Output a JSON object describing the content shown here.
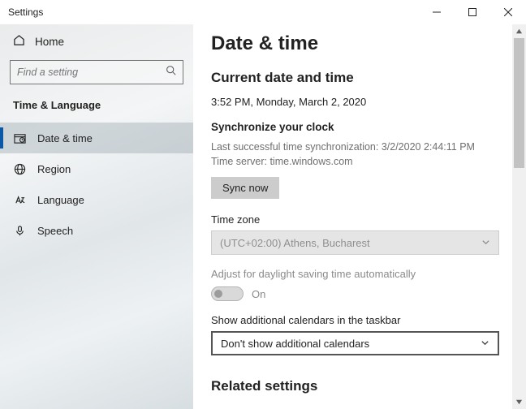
{
  "window": {
    "title": "Settings"
  },
  "sidebar": {
    "home": "Home",
    "search_placeholder": "Find a setting",
    "category": "Time & Language",
    "items": [
      {
        "icon": "clock-icon",
        "label": "Date & time",
        "active": true
      },
      {
        "icon": "globe-icon",
        "label": "Region",
        "active": false
      },
      {
        "icon": "language-icon",
        "label": "Language",
        "active": false
      },
      {
        "icon": "mic-icon",
        "label": "Speech",
        "active": false
      }
    ]
  },
  "main": {
    "title": "Date & time",
    "current_section": "Current date and time",
    "current_value": "3:52 PM, Monday, March 2, 2020",
    "sync_heading": "Synchronize your clock",
    "sync_last": "Last successful time synchronization: 3/2/2020 2:44:11 PM",
    "sync_server": "Time server: time.windows.com",
    "sync_button": "Sync now",
    "tz_label": "Time zone",
    "tz_value": "(UTC+02:00) Athens, Bucharest",
    "dst_label": "Adjust for daylight saving time automatically",
    "dst_state": "On",
    "calendars_label": "Show additional calendars in the taskbar",
    "calendars_value": "Don't show additional calendars",
    "related": "Related settings"
  }
}
